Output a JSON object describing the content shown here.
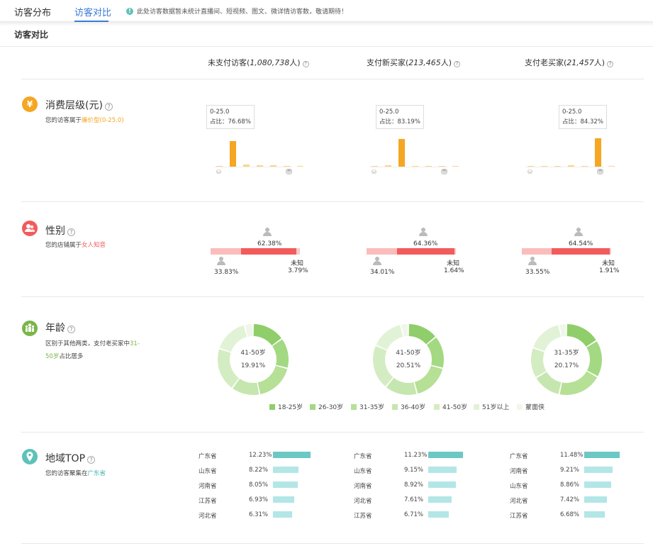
{
  "tabs": [
    {
      "label": "访客分布",
      "active": false
    },
    {
      "label": "访客对比",
      "active": true
    }
  ],
  "notice": "此处访客数据暂未统计直播间、短视频、图文、微详情访客数，敬请期待！",
  "section_title": "访客对比",
  "columns": [
    {
      "label_prefix": "未支付访客(",
      "count": "1,080,738",
      "label_suffix": "人)"
    },
    {
      "label_prefix": "支付新买家(",
      "count": "213,465",
      "label_suffix": "人)"
    },
    {
      "label_prefix": "支付老买家(",
      "count": "21,457",
      "label_suffix": "人)"
    }
  ],
  "consumption": {
    "title": "消费层级(元)",
    "desc_prefix": "您的访客属于",
    "desc_highlight": "廉价型(0-25.0)",
    "icon": "yen-icon",
    "color": "#f5a623",
    "cols": [
      {
        "tip_range": "0-25.0",
        "tip_share": "占比：76.68%",
        "values": [
          1.5,
          76.68,
          6.5,
          5.0,
          3.5,
          1.5,
          1.0
        ]
      },
      {
        "tip_range": "0-25.0",
        "tip_share": "占比：83.19%",
        "values": [
          1.0,
          5.0,
          83.19,
          1.5,
          2.0,
          1.5,
          1.5
        ]
      },
      {
        "tip_range": "0-25.0",
        "tip_share": "占比：84.32%",
        "values": [
          1.0,
          3.0,
          3.0,
          3.5,
          1.5,
          84.32,
          1.0
        ]
      }
    ]
  },
  "gender": {
    "title": "性别",
    "desc_prefix": "您的店铺属于",
    "desc_highlight": "女人知音",
    "icon": "users-icon",
    "color": "#f25b5b",
    "unknown_label": "未知",
    "cols": [
      {
        "female": "62.38%",
        "male": "33.83%",
        "unknown": "3.79%",
        "female_v": 62.38,
        "male_v": 33.83,
        "unknown_v": 3.79
      },
      {
        "female": "64.36%",
        "male": "34.01%",
        "unknown": "1.64%",
        "female_v": 64.36,
        "male_v": 34.01,
        "unknown_v": 1.64
      },
      {
        "female": "64.54%",
        "male": "33.55%",
        "unknown": "1.91%",
        "female_v": 64.54,
        "male_v": 33.55,
        "unknown_v": 1.91
      }
    ]
  },
  "age": {
    "title": "年龄",
    "desc_line1_prefix": "区别于其他两类，支付老买家中",
    "desc_line1_highlight": "31-",
    "desc_line2_highlight": "50岁",
    "desc_line2_suffix": "占比居多",
    "icon": "people-icon",
    "color": "#7ab648",
    "legend": [
      {
        "label": "18-25岁",
        "color": "#8fce6a"
      },
      {
        "label": "26-30岁",
        "color": "#a3d982"
      },
      {
        "label": "31-35岁",
        "color": "#b5e096"
      },
      {
        "label": "36-40岁",
        "color": "#c6e6af"
      },
      {
        "label": "41-50岁",
        "color": "#d4ecc2"
      },
      {
        "label": "51岁以上",
        "color": "#e2f2d6"
      },
      {
        "label": "蒙面侠",
        "color": "#f0f7ea"
      }
    ],
    "cols": [
      {
        "center_label": "41-50岁",
        "center_value": "19.91%",
        "values": [
          15,
          14,
          18,
          13,
          19.91,
          16,
          4
        ]
      },
      {
        "center_label": "41-50岁",
        "center_value": "20.51%",
        "values": [
          14,
          15,
          17,
          15,
          20.51,
          15,
          3.5
        ]
      },
      {
        "center_label": "31-35岁",
        "center_value": "20.17%",
        "values": [
          16,
          17,
          20.17,
          13,
          14,
          16,
          3.5
        ]
      }
    ]
  },
  "region": {
    "title": "地域TOP",
    "desc_prefix": "您的访客聚集在",
    "desc_highlight": "广东省",
    "icon": "location-icon",
    "color": "#5ec2b8",
    "cols": [
      {
        "rows": [
          {
            "name": "广东省",
            "pct": "12.23%",
            "v": 12.23
          },
          {
            "name": "山东省",
            "pct": "8.22%",
            "v": 8.22
          },
          {
            "name": "河南省",
            "pct": "8.05%",
            "v": 8.05
          },
          {
            "name": "江苏省",
            "pct": "6.93%",
            "v": 6.93
          },
          {
            "name": "河北省",
            "pct": "6.31%",
            "v": 6.31
          }
        ]
      },
      {
        "rows": [
          {
            "name": "广东省",
            "pct": "11.23%",
            "v": 11.23
          },
          {
            "name": "山东省",
            "pct": "9.15%",
            "v": 9.15
          },
          {
            "name": "河南省",
            "pct": "8.92%",
            "v": 8.92
          },
          {
            "name": "河北省",
            "pct": "7.61%",
            "v": 7.61
          },
          {
            "name": "江苏省",
            "pct": "6.71%",
            "v": 6.71
          }
        ]
      },
      {
        "rows": [
          {
            "name": "广东省",
            "pct": "11.48%",
            "v": 11.48
          },
          {
            "name": "河南省",
            "pct": "9.21%",
            "v": 9.21
          },
          {
            "name": "山东省",
            "pct": "8.86%",
            "v": 8.86
          },
          {
            "name": "河北省",
            "pct": "7.42%",
            "v": 7.42
          },
          {
            "name": "江苏省",
            "pct": "6.68%",
            "v": 6.68
          }
        ]
      }
    ]
  }
}
